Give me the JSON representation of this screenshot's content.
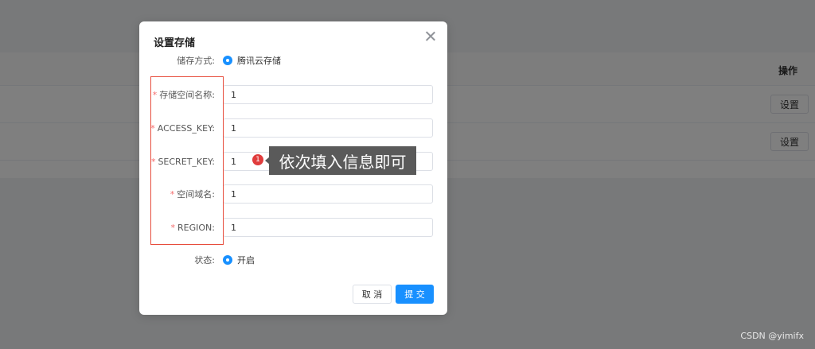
{
  "background": {
    "operation_header": "操作",
    "row_buttons": [
      "设置",
      "设置"
    ]
  },
  "dialog": {
    "title": "设置存储",
    "storage_type": {
      "label": "储存方式:",
      "option": "腾讯云存储"
    },
    "fields": [
      {
        "label": "存储空间名称:",
        "value": "1"
      },
      {
        "label": "ACCESS_KEY:",
        "value": "1"
      },
      {
        "label": "SECRET_KEY:",
        "value": "1"
      },
      {
        "label": "空间域名:",
        "value": "1"
      },
      {
        "label": "REGION:",
        "value": "1"
      }
    ],
    "status": {
      "label": "状态:",
      "option": "开启"
    },
    "cancel_label": "取 消",
    "submit_label": "提 交"
  },
  "annotation": {
    "badge": "1",
    "text": "依次填入信息即可"
  },
  "watermark": "CSDN @yimifx",
  "colors": {
    "primary": "#1890ff",
    "required": "#f56c6c",
    "highlight_box": "#e74c3c",
    "annotation_bg": "#5a5a5a"
  }
}
